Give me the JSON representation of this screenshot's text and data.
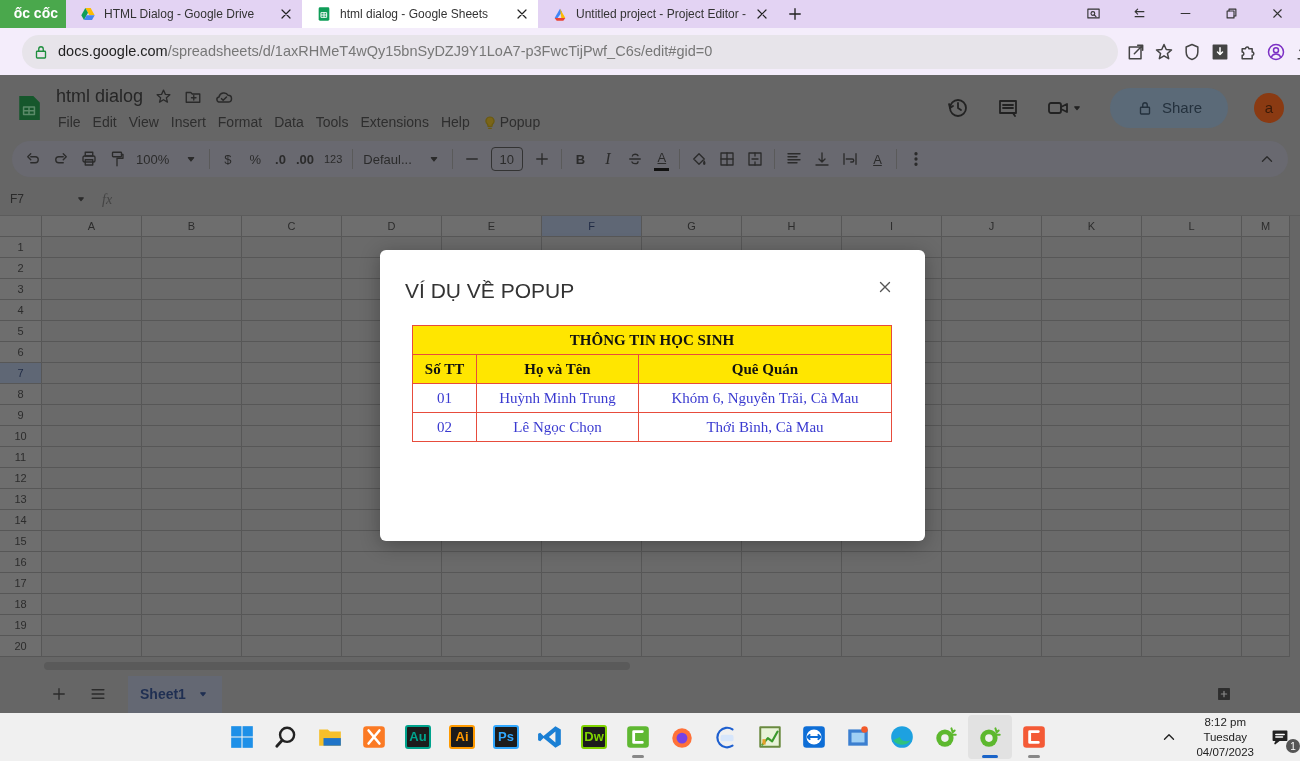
{
  "browser": {
    "logo": "ốc cốc",
    "tabs": [
      {
        "title": "HTML Dialog - Google Drive",
        "selected": false
      },
      {
        "title": "html dialog - Google Sheets",
        "selected": true
      },
      {
        "title": "Untitled project - Project Editor -",
        "selected": false
      }
    ],
    "address": {
      "host": "docs.google.com",
      "path": "/spreadsheets/d/1axRHMeT4wQy15bnSyDZJ9Y1LoA7-p3FwcTijPwf_C6s/edit#gid=0"
    }
  },
  "sheets": {
    "title": "html dialog",
    "menu": [
      "File",
      "Edit",
      "View",
      "Insert",
      "Format",
      "Data",
      "Tools",
      "Extensions",
      "Help"
    ],
    "addon_menu": "Popup",
    "share": "Share",
    "avatar": "a",
    "toolbar": {
      "zoom": "100%",
      "currency": "$",
      "percent": "%",
      "decrease_decimal": ".0",
      "increase_decimal": ".00",
      "more_formats": "123",
      "font": "Defaul...",
      "font_size": "10",
      "bold": "B",
      "italic": "I",
      "text_color": "A",
      "text_rotation": "A"
    },
    "name_box": "F7",
    "fx": "fx",
    "columns": [
      {
        "label": "A",
        "selected": false
      },
      {
        "label": "B",
        "selected": false
      },
      {
        "label": "C",
        "selected": false
      },
      {
        "label": "D",
        "selected": false
      },
      {
        "label": "E",
        "selected": false
      },
      {
        "label": "F",
        "selected": true
      },
      {
        "label": "G",
        "selected": false
      },
      {
        "label": "H",
        "selected": false
      },
      {
        "label": "I",
        "selected": false
      },
      {
        "label": "J",
        "selected": false
      },
      {
        "label": "K",
        "selected": false
      },
      {
        "label": "L",
        "selected": false
      },
      {
        "label": "M",
        "selected": false
      }
    ],
    "rows": [
      {
        "label": "1",
        "selected": false
      },
      {
        "label": "2",
        "selected": false
      },
      {
        "label": "3",
        "selected": false
      },
      {
        "label": "4",
        "selected": false
      },
      {
        "label": "5",
        "selected": false
      },
      {
        "label": "6",
        "selected": false
      },
      {
        "label": "7",
        "selected": true
      },
      {
        "label": "8",
        "selected": false
      },
      {
        "label": "9",
        "selected": false
      },
      {
        "label": "10",
        "selected": false
      },
      {
        "label": "11",
        "selected": false
      },
      {
        "label": "12",
        "selected": false
      },
      {
        "label": "13",
        "selected": false
      },
      {
        "label": "14",
        "selected": false
      },
      {
        "label": "15",
        "selected": false
      },
      {
        "label": "16",
        "selected": false
      },
      {
        "label": "17",
        "selected": false
      },
      {
        "label": "18",
        "selected": false
      },
      {
        "label": "19",
        "selected": false
      },
      {
        "label": "20",
        "selected": false
      }
    ],
    "sheet_tab": "Sheet1"
  },
  "dialog": {
    "title": "VÍ DỤ VỀ POPUP",
    "table": {
      "title": "THÔNG TIN HỌC SINH",
      "columns": [
        "Số TT",
        "Họ và Tên",
        "Quê Quán"
      ],
      "rows": [
        [
          "01",
          "Huỳnh Minh Trung",
          "Khóm 6, Nguyễn Trãi, Cà Mau"
        ],
        [
          "02",
          "Lê Ngọc Chọn",
          "Thới Bình, Cà Mau"
        ]
      ]
    }
  },
  "taskbar": {
    "apps": [
      {
        "kind": "start",
        "running": false,
        "active": false
      },
      {
        "kind": "search",
        "running": false,
        "active": false
      },
      {
        "kind": "folder",
        "running": false,
        "active": false
      },
      {
        "kind": "xampp",
        "running": false,
        "active": false
      },
      {
        "kind": "adobe",
        "label": "Au",
        "color": "#00a38d",
        "running": false,
        "active": false
      },
      {
        "kind": "adobe",
        "label": "Ai",
        "color": "#ff9a00",
        "running": false,
        "active": false
      },
      {
        "kind": "adobe",
        "label": "Ps",
        "color": "#31a8ff",
        "running": false,
        "active": false
      },
      {
        "kind": "vscode",
        "running": false,
        "active": false
      },
      {
        "kind": "adobe",
        "label": "Dw",
        "color": "#7fd300",
        "running": false,
        "active": false
      },
      {
        "kind": "camtasia",
        "running": true,
        "active": false
      },
      {
        "kind": "firefox",
        "running": false,
        "active": false
      },
      {
        "kind": "zalo",
        "running": false,
        "active": false
      },
      {
        "kind": "chart",
        "running": false,
        "active": false
      },
      {
        "kind": "teamviewer",
        "running": false,
        "active": false
      },
      {
        "kind": "photo",
        "running": false,
        "active": false
      },
      {
        "kind": "edge",
        "running": false,
        "active": false
      },
      {
        "kind": "coccoc",
        "running": false,
        "active": false
      },
      {
        "kind": "coccoc",
        "running": true,
        "active": true
      },
      {
        "kind": "camtasia-c",
        "running": true,
        "active": false
      }
    ],
    "time": "8:12 pm",
    "day": "Tuesday",
    "date": "04/07/2023",
    "notifications": "1"
  }
}
